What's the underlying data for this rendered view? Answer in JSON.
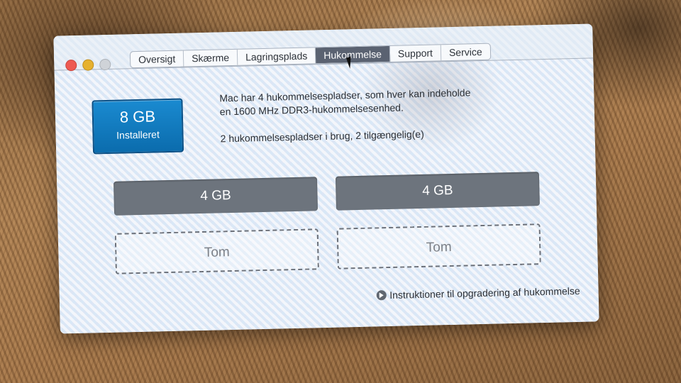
{
  "window": {
    "tabs": [
      {
        "label": "Oversigt"
      },
      {
        "label": "Skærme"
      },
      {
        "label": "Lagringsplads"
      },
      {
        "label": "Hukommelse",
        "active": true
      },
      {
        "label": "Support"
      },
      {
        "label": "Service"
      }
    ]
  },
  "memory": {
    "installed_size": "8 GB",
    "installed_label": "Installeret",
    "info_line1": "Mac har 4 hukommelsespladser, som hver kan indeholde",
    "info_line2": "en 1600 MHz DDR3-hukommelsesenhed.",
    "info_line3": "2 hukommelsespladser i brug, 2 tilgængelig(e)",
    "slots": [
      {
        "label": "4 GB",
        "status": "used"
      },
      {
        "label": "4 GB",
        "status": "used"
      },
      {
        "label": "Tom",
        "status": "empty"
      },
      {
        "label": "Tom",
        "status": "empty"
      }
    ],
    "upgrade_link": "Instruktioner til opgradering af hukommelse"
  },
  "colors": {
    "accent": "#0b6cad",
    "active_tab": "#5a6271",
    "slot_used": "#6d747d"
  },
  "icons": [
    "close-icon",
    "minimize-icon",
    "zoom-icon",
    "arrow-circle-icon",
    "mouse-cursor-icon"
  ]
}
